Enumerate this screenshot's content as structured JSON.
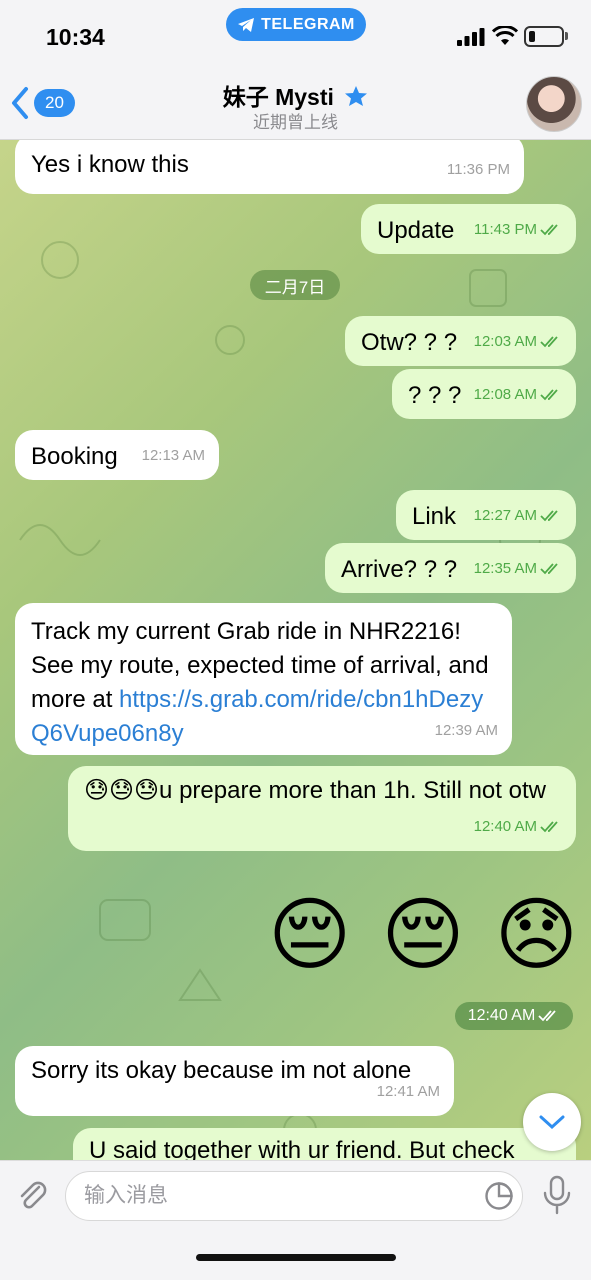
{
  "status": {
    "time": "10:34",
    "badge": "TELEGRAM"
  },
  "header": {
    "back_count": "20",
    "title": "妹子 Mysti",
    "subtitle": "近期曾上线"
  },
  "messages": [
    {
      "text": "Yes i know this",
      "time": "11:36 PM"
    },
    {
      "text": "Update",
      "time": "11:43 PM"
    },
    {
      "text": "Otw? ? ?",
      "time": "12:03 AM"
    },
    {
      "text": "? ? ?",
      "time": "12:08 AM"
    },
    {
      "text": "Booking",
      "time": "12:13 AM"
    },
    {
      "text": "Link",
      "time": "12:27 AM"
    },
    {
      "text": "Arrive? ? ?",
      "time": "12:35 AM"
    },
    {
      "text_before": "Track my current Grab ride in NHR2216! See my route, expected time of arrival, and more at ",
      "link": "https://s.grab.com/ride/cbn1hDezyQ6Vupe06n8y",
      "time": "12:39 AM"
    },
    {
      "text": "😓😓😓u prepare more than 1h. Still not otw",
      "time": "12:40 AM"
    },
    {
      "emojis": [
        "😔",
        "😔",
        "😞"
      ],
      "time": "12:40 AM"
    },
    {
      "text": "Sorry its okay because im not alone",
      "time": "12:41 AM"
    },
    {
      "text": "U said together with ur friend. But check"
    }
  ],
  "date_separator": "二月7日",
  "input": {
    "placeholder": "输入消息"
  },
  "colors": {
    "accent": "#2f8ef0",
    "outgoing": "#e5fbcf",
    "incoming": "#ffffff",
    "read_check": "#4faa48"
  }
}
